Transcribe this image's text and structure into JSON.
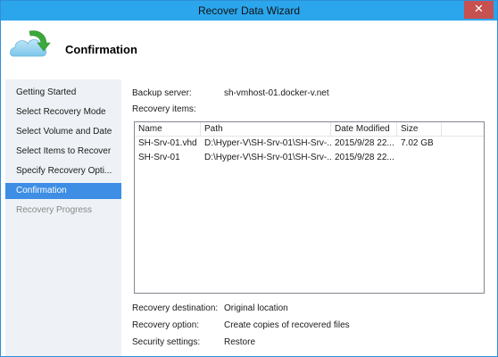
{
  "window": {
    "title": "Recover Data Wizard",
    "close_glyph": "✕"
  },
  "header": {
    "heading": "Confirmation",
    "icon": "recover-cloud-arrow-icon"
  },
  "sidebar": {
    "items": [
      {
        "label": "Getting Started",
        "state": "normal"
      },
      {
        "label": "Select Recovery Mode",
        "state": "normal"
      },
      {
        "label": "Select Volume and Date",
        "state": "normal"
      },
      {
        "label": "Select Items to Recover",
        "state": "normal"
      },
      {
        "label": "Specify Recovery Opti...",
        "state": "normal"
      },
      {
        "label": "Confirmation",
        "state": "active"
      },
      {
        "label": "Recovery Progress",
        "state": "disabled"
      }
    ]
  },
  "main": {
    "backup_server_label": "Backup server:",
    "backup_server_value": "sh-vmhost-01.docker-v.net",
    "recovery_items_label": "Recovery items:",
    "table": {
      "columns": [
        "Name",
        "Path",
        "Date Modified",
        "Size"
      ],
      "rows": [
        [
          "SH-Srv-01.vhd",
          "D:\\Hyper-V\\SH-Srv-01\\SH-Srv-...",
          "2015/9/28 22...",
          "7.02 GB"
        ],
        [
          "SH-Srv-01",
          "D:\\Hyper-V\\SH-Srv-01\\SH-Srv-...",
          "2015/9/28 22...",
          ""
        ]
      ]
    },
    "recovery_destination_label": "Recovery destination:",
    "recovery_destination_value": "Original location",
    "recovery_option_label": "Recovery option:",
    "recovery_option_value": "Create copies of recovered files",
    "security_settings_label": "Security settings:",
    "security_settings_value": "Restore"
  },
  "colors": {
    "titlebar": "#2ba6ec",
    "close_button": "#c75050",
    "sidebar_bg": "#eef2f6",
    "active_item": "#3d8ee4"
  }
}
